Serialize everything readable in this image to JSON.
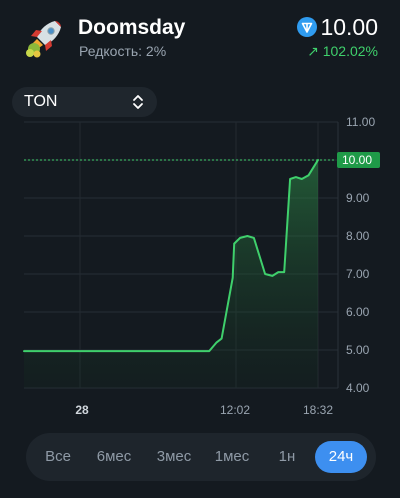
{
  "item": {
    "name": "Doomsday",
    "rarity": "Редкость: 2%",
    "price": "10.00",
    "change": "↗ 102.02%"
  },
  "currency": {
    "selected": "TON"
  },
  "icons": {
    "nft": "rocket-icon",
    "currency": "ton-icon",
    "select": "chevron-updown-icon"
  },
  "colors": {
    "accent": "#3d8ff0",
    "up": "#3fd06c",
    "line": "#3fd06c",
    "price_tag": "#1f9a48"
  },
  "chart_data": {
    "type": "area",
    "x": [
      "27 18:32",
      "27 20:00",
      "27 22:00",
      "28 00:00",
      "28 02:00",
      "28 04:00",
      "28 06:00",
      "28 08:00",
      "28 10:00",
      "28 10:30",
      "28 11:00",
      "28 11:30",
      "28 12:00",
      "28 12:30",
      "28 13:00",
      "28 13:30",
      "28 14:00",
      "28 14:30",
      "28 15:00",
      "28 15:30",
      "28 16:00",
      "28 16:30",
      "28 17:00",
      "28 17:30",
      "28 18:00",
      "28 18:32"
    ],
    "y": [
      4.97,
      4.97,
      4.97,
      4.97,
      4.97,
      4.97,
      4.97,
      4.97,
      4.97,
      5.2,
      5.3,
      6.9,
      7.8,
      7.95,
      8.0,
      7.95,
      7.5,
      7.0,
      6.95,
      7.05,
      7.05,
      9.5,
      9.55,
      9.5,
      9.6,
      10.0
    ],
    "ylim": [
      4.0,
      11.0
    ],
    "y_ticks": [
      "4.00",
      "5.00",
      "6.00",
      "7.00",
      "8.00",
      "9.00",
      "10.00",
      "11.00"
    ],
    "x_ticks": [
      "28",
      "12:02",
      "18:32"
    ],
    "current_label": "10.00",
    "grid": true
  },
  "tabs": [
    {
      "label": "Все",
      "active": false
    },
    {
      "label": "6мес",
      "active": false
    },
    {
      "label": "3мес",
      "active": false
    },
    {
      "label": "1мес",
      "active": false
    },
    {
      "label": "1н",
      "active": false
    },
    {
      "label": "24ч",
      "active": true
    }
  ]
}
